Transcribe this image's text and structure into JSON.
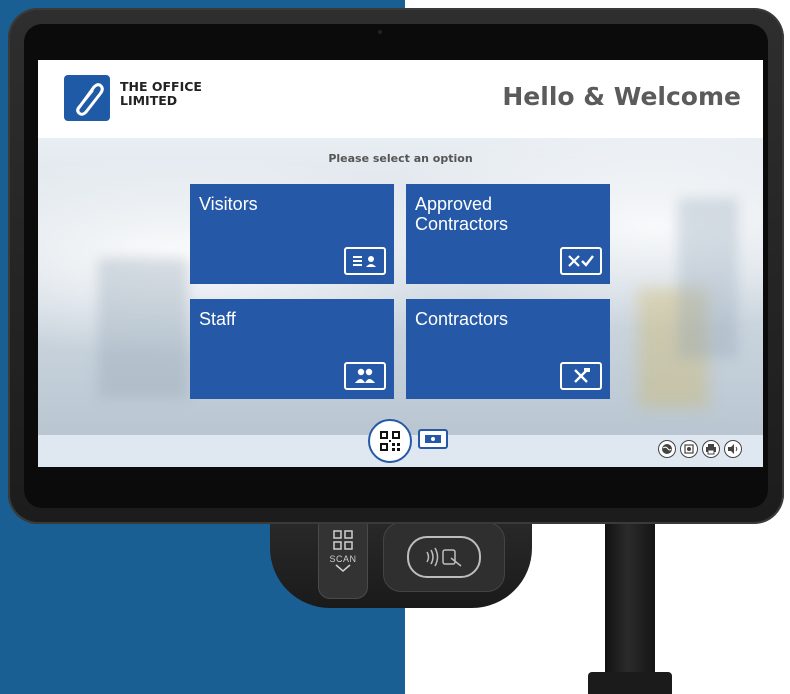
{
  "header": {
    "brand_line1": "THE OFFICE",
    "brand_line2": "LIMITED",
    "welcome": "Hello & Welcome"
  },
  "main": {
    "prompt": "Please select an option",
    "tiles": [
      {
        "label": "Visitors",
        "icon": "id-card-icon"
      },
      {
        "label": "Approved Contractors",
        "icon": "tools-check-icon"
      },
      {
        "label": "Staff",
        "icon": "group-icon"
      },
      {
        "label": "Contractors",
        "icon": "tools-icon"
      }
    ]
  },
  "footer": {
    "buttons": [
      "qr-code-icon",
      "id-card-icon"
    ],
    "utilities": [
      "globe-icon",
      "accessibility-icon",
      "print-icon",
      "volume-icon"
    ]
  },
  "hardware": {
    "scan_label": "SCAN"
  },
  "colors": {
    "tile_blue": "#2559a8",
    "page_blue": "#1a5f93"
  }
}
